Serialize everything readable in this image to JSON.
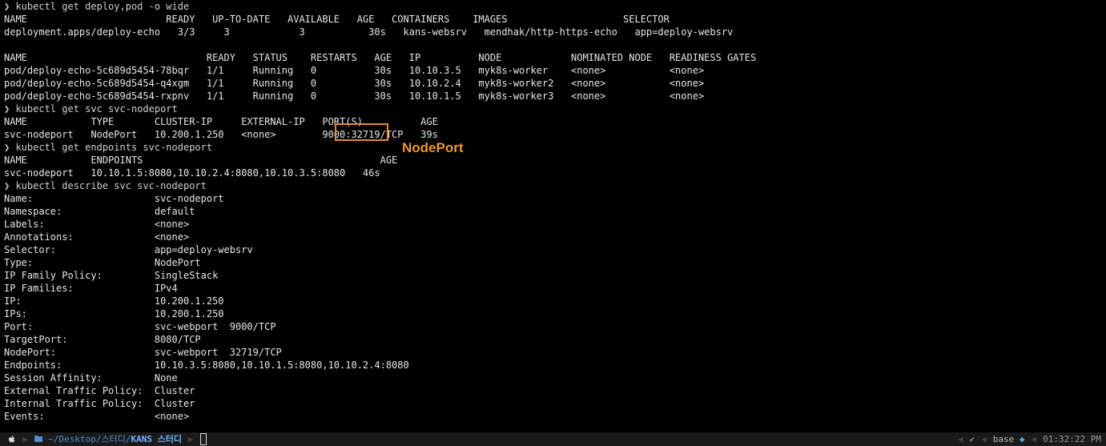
{
  "terminal": {
    "lines": [
      "❯ kubectl get deploy,pod -o wide",
      "NAME                        READY   UP-TO-DATE   AVAILABLE   AGE   CONTAINERS    IMAGES                    SELECTOR",
      "deployment.apps/deploy-echo   3/3     3            3           30s   kans-websrv   mendhak/http-https-echo   app=deploy-websrv",
      "",
      "NAME                               READY   STATUS    RESTARTS   AGE   IP          NODE            NOMINATED NODE   READINESS GATES",
      "pod/deploy-echo-5c689d5454-78bqr   1/1     Running   0          30s   10.10.3.5   myk8s-worker    <none>           <none>",
      "pod/deploy-echo-5c689d5454-q4xgm   1/1     Running   0          30s   10.10.2.4   myk8s-worker2   <none>           <none>",
      "pod/deploy-echo-5c689d5454-rxpnv   1/1     Running   0          30s   10.10.1.5   myk8s-worker3   <none>           <none>",
      "❯ kubectl get svc svc-nodeport",
      "NAME           TYPE       CLUSTER-IP     EXTERNAL-IP   PORT(S)          AGE",
      "svc-nodeport   NodePort   10.200.1.250   <none>        9000:32719/TCP   39s",
      "❯ kubectl get endpoints svc-nodeport",
      "NAME           ENDPOINTS                                         AGE",
      "svc-nodeport   10.10.1.5:8080,10.10.2.4:8080,10.10.3.5:8080   46s",
      "❯ kubectl describe svc svc-nodeport",
      "Name:                     svc-nodeport",
      "Namespace:                default",
      "Labels:                   <none>",
      "Annotations:              <none>",
      "Selector:                 app=deploy-websrv",
      "Type:                     NodePort",
      "IP Family Policy:         SingleStack",
      "IP Families:              IPv4",
      "IP:                       10.200.1.250",
      "IPs:                      10.200.1.250",
      "Port:                     svc-webport  9000/TCP",
      "TargetPort:               8080/TCP",
      "NodePort:                 svc-webport  32719/TCP",
      "Endpoints:                10.10.3.5:8080,10.10.1.5:8080,10.10.2.4:8080",
      "Session Affinity:         None",
      "External Traffic Policy:  Cluster",
      "Internal Traffic Policy:  Cluster",
      "Events:                   <none>"
    ]
  },
  "annotation": {
    "label": "NodePort",
    "color": "#f0952a"
  },
  "statusbar": {
    "apple_icon": "apple-icon",
    "folder_icon": "folder-icon",
    "path_prefix": "~/Desktop/스터디/",
    "path_current": "KANS 스터디",
    "check": "✔",
    "env": "base",
    "time": "01:32:22 PM"
  }
}
